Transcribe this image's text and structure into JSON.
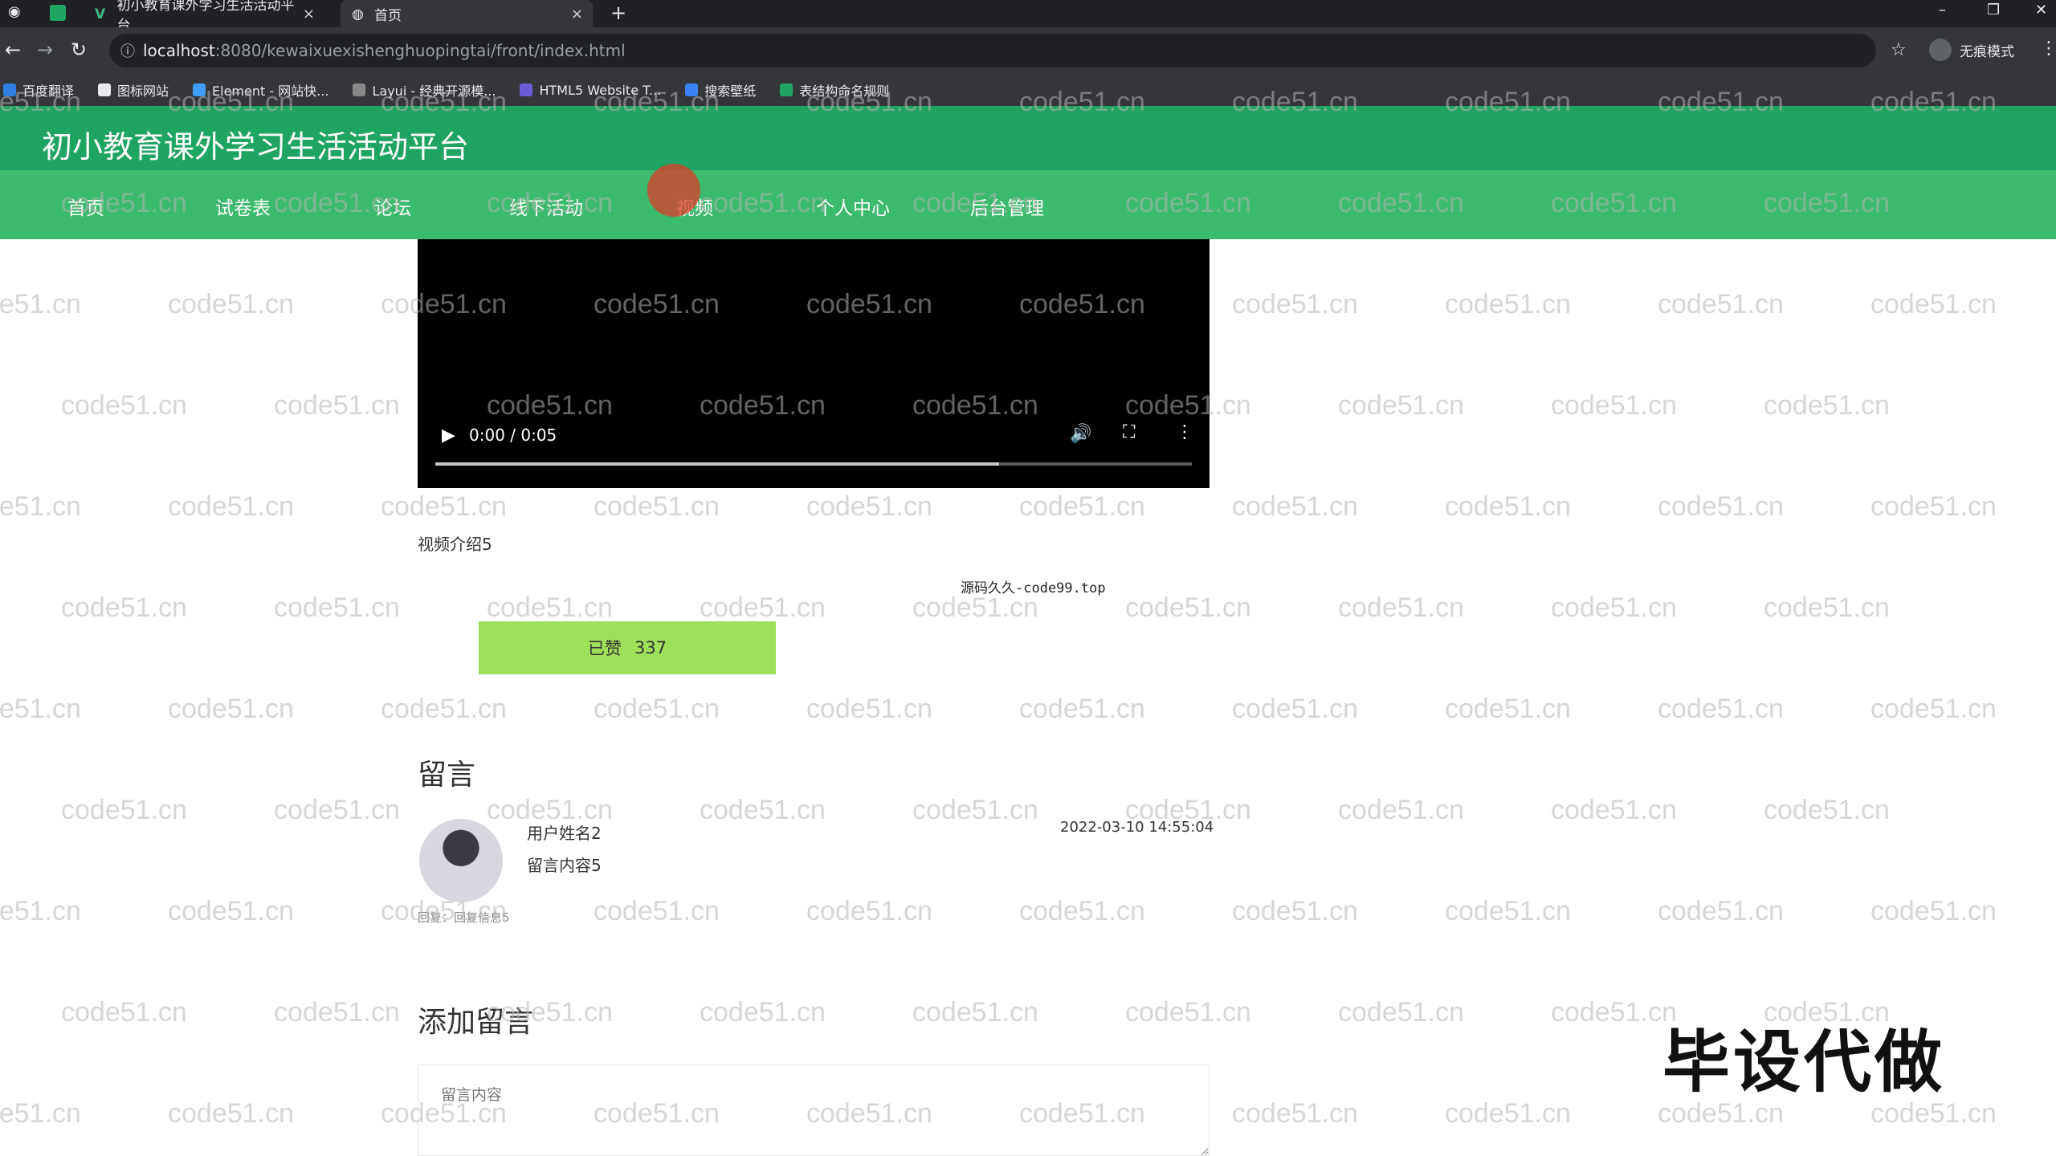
{
  "browser": {
    "tabs": [
      {
        "label": "初小教育课外学习生活活动平台"
      },
      {
        "label": "首页"
      }
    ],
    "url_host": "localhost",
    "url_path": ":8080/kewaixuexishenghuopingtai/front/index.html",
    "profile_label": "无痕模式",
    "bookmarks": [
      {
        "label": "百度翻译"
      },
      {
        "label": "图标网站"
      },
      {
        "label": "Element - 网站快..."
      },
      {
        "label": "Layui - 经典开源模..."
      },
      {
        "label": "HTML5 Website T..."
      },
      {
        "label": "搜索壁纸"
      },
      {
        "label": "表结构命名规则"
      }
    ]
  },
  "site": {
    "title": "初小教育课外学习生活活动平台",
    "nav": [
      {
        "label": "首页"
      },
      {
        "label": "试卷表"
      },
      {
        "label": "论坛"
      },
      {
        "label": "线下活动"
      },
      {
        "label": "视频"
      },
      {
        "label": "个人中心"
      },
      {
        "label": "后台管理"
      }
    ]
  },
  "video": {
    "time": "0:00 / 0:05",
    "progress_fraction": 0.745,
    "description": "视频介绍5"
  },
  "source_text": "源码久久-code99.top",
  "like": {
    "label": "已赞",
    "count": "337"
  },
  "comments": {
    "heading": "留言",
    "items": [
      {
        "user": "用户姓名2",
        "content": "留言内容5",
        "time": "2022-03-10 14:55:04",
        "reply": "回复：回复信息5"
      }
    ]
  },
  "add_comment": {
    "heading": "添加留言",
    "placeholder": "留言内容"
  },
  "watermark_text": "code51.cn",
  "stamp_text": "毕设代做",
  "colors": {
    "header": "#1fa463",
    "nav": "#3dbb6c",
    "like": "#9de05a"
  }
}
